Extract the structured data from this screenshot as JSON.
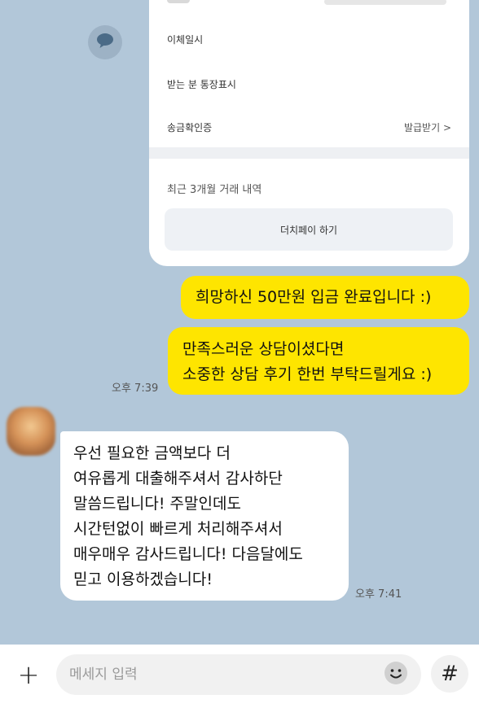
{
  "card": {
    "rows": [
      {
        "label": "이체일시"
      },
      {
        "label": "받는 분 통장표시"
      },
      {
        "label": "송금확인증",
        "action": "발급받기 >"
      }
    ],
    "recent_label": "최근 3개월 거래 내역",
    "button_label": "더치페이 하기"
  },
  "messages": [
    {
      "sender": "me",
      "text": "희망하신 50만원 입금 완료입니다 :)"
    },
    {
      "sender": "me",
      "text": "만족스러운 상담이셨다면\n소중한 상담 후기 한번 부탁드릴게요 :)",
      "time": "오후 7:39"
    },
    {
      "sender": "other",
      "text": "우선 필요한 금액보다 더\n여유롭게 대출해주셔서 감사하단\n말씀드립니다! 주말인데도\n시간턴없이 빠르게 처리해주셔서\n매우매우 감사드립니다! 다음달에도\n믿고 이용하겠습니다!",
      "time": "오후 7:41"
    }
  ],
  "input_bar": {
    "plus": "+",
    "placeholder": "메세지 입력",
    "hash": "#"
  },
  "icons": {
    "share": "share-speech-icon",
    "emoji": "emoji-icon",
    "avatar": "avatar"
  },
  "colors": {
    "background": "#b2c7d9",
    "my_bubble": "#fee500",
    "other_bubble": "#ffffff"
  }
}
